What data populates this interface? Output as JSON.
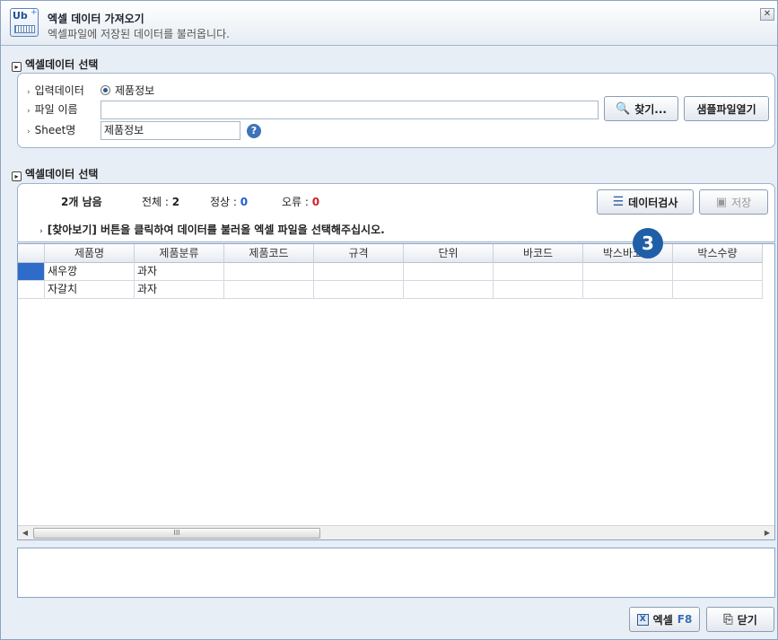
{
  "window": {
    "title": "엑셀 데이터 가져오기",
    "subtitle": "엑셀파일에 저장된 데이터를 불러옵니다.",
    "close_label": "✕"
  },
  "section1": {
    "title": "엑셀데이터 선택",
    "input_data_label": "입력데이터",
    "radio_option": "제품정보",
    "file_name_label": "파일 이름",
    "file_name_value": "",
    "sheet_label": "Sheet명",
    "sheet_value": "제품정보",
    "browse_button": "찾기...",
    "sample_button": "샘플파일열기",
    "help_label": "?"
  },
  "section2": {
    "title": "엑셀데이터 선택",
    "remaining": "2개 남음",
    "total_label": "전체 : ",
    "total_value": "2",
    "normal_label": "정상 : ",
    "normal_value": "0",
    "error_label": "오류 : ",
    "error_value": "0",
    "instruction": "[찾아보기] 버튼을 클릭하여 데이터를 불러올 엑셀 파일을 선택해주십시오.",
    "check_button": "데이터검사",
    "save_button": "저장"
  },
  "grid": {
    "columns": [
      "제품명",
      "제품분류",
      "제품코드",
      "규격",
      "단위",
      "바코드",
      "박스바코드",
      "박스수량"
    ],
    "rows": [
      [
        "새우깡",
        "과자",
        "",
        "",
        "",
        "",
        "",
        ""
      ],
      [
        "자갈치",
        "과자",
        "",
        "",
        "",
        "",
        "",
        ""
      ]
    ],
    "scroll_thumb_glyph": "III"
  },
  "badge": "3",
  "footer": {
    "excel_button": "엑셀",
    "excel_shortcut": "F8",
    "close_button": "닫기"
  },
  "colors": {
    "accent": "#2f6bc9",
    "normal_count": "#1f5fd0",
    "error_count": "#d0202a",
    "badge": "#1f5fa8"
  }
}
